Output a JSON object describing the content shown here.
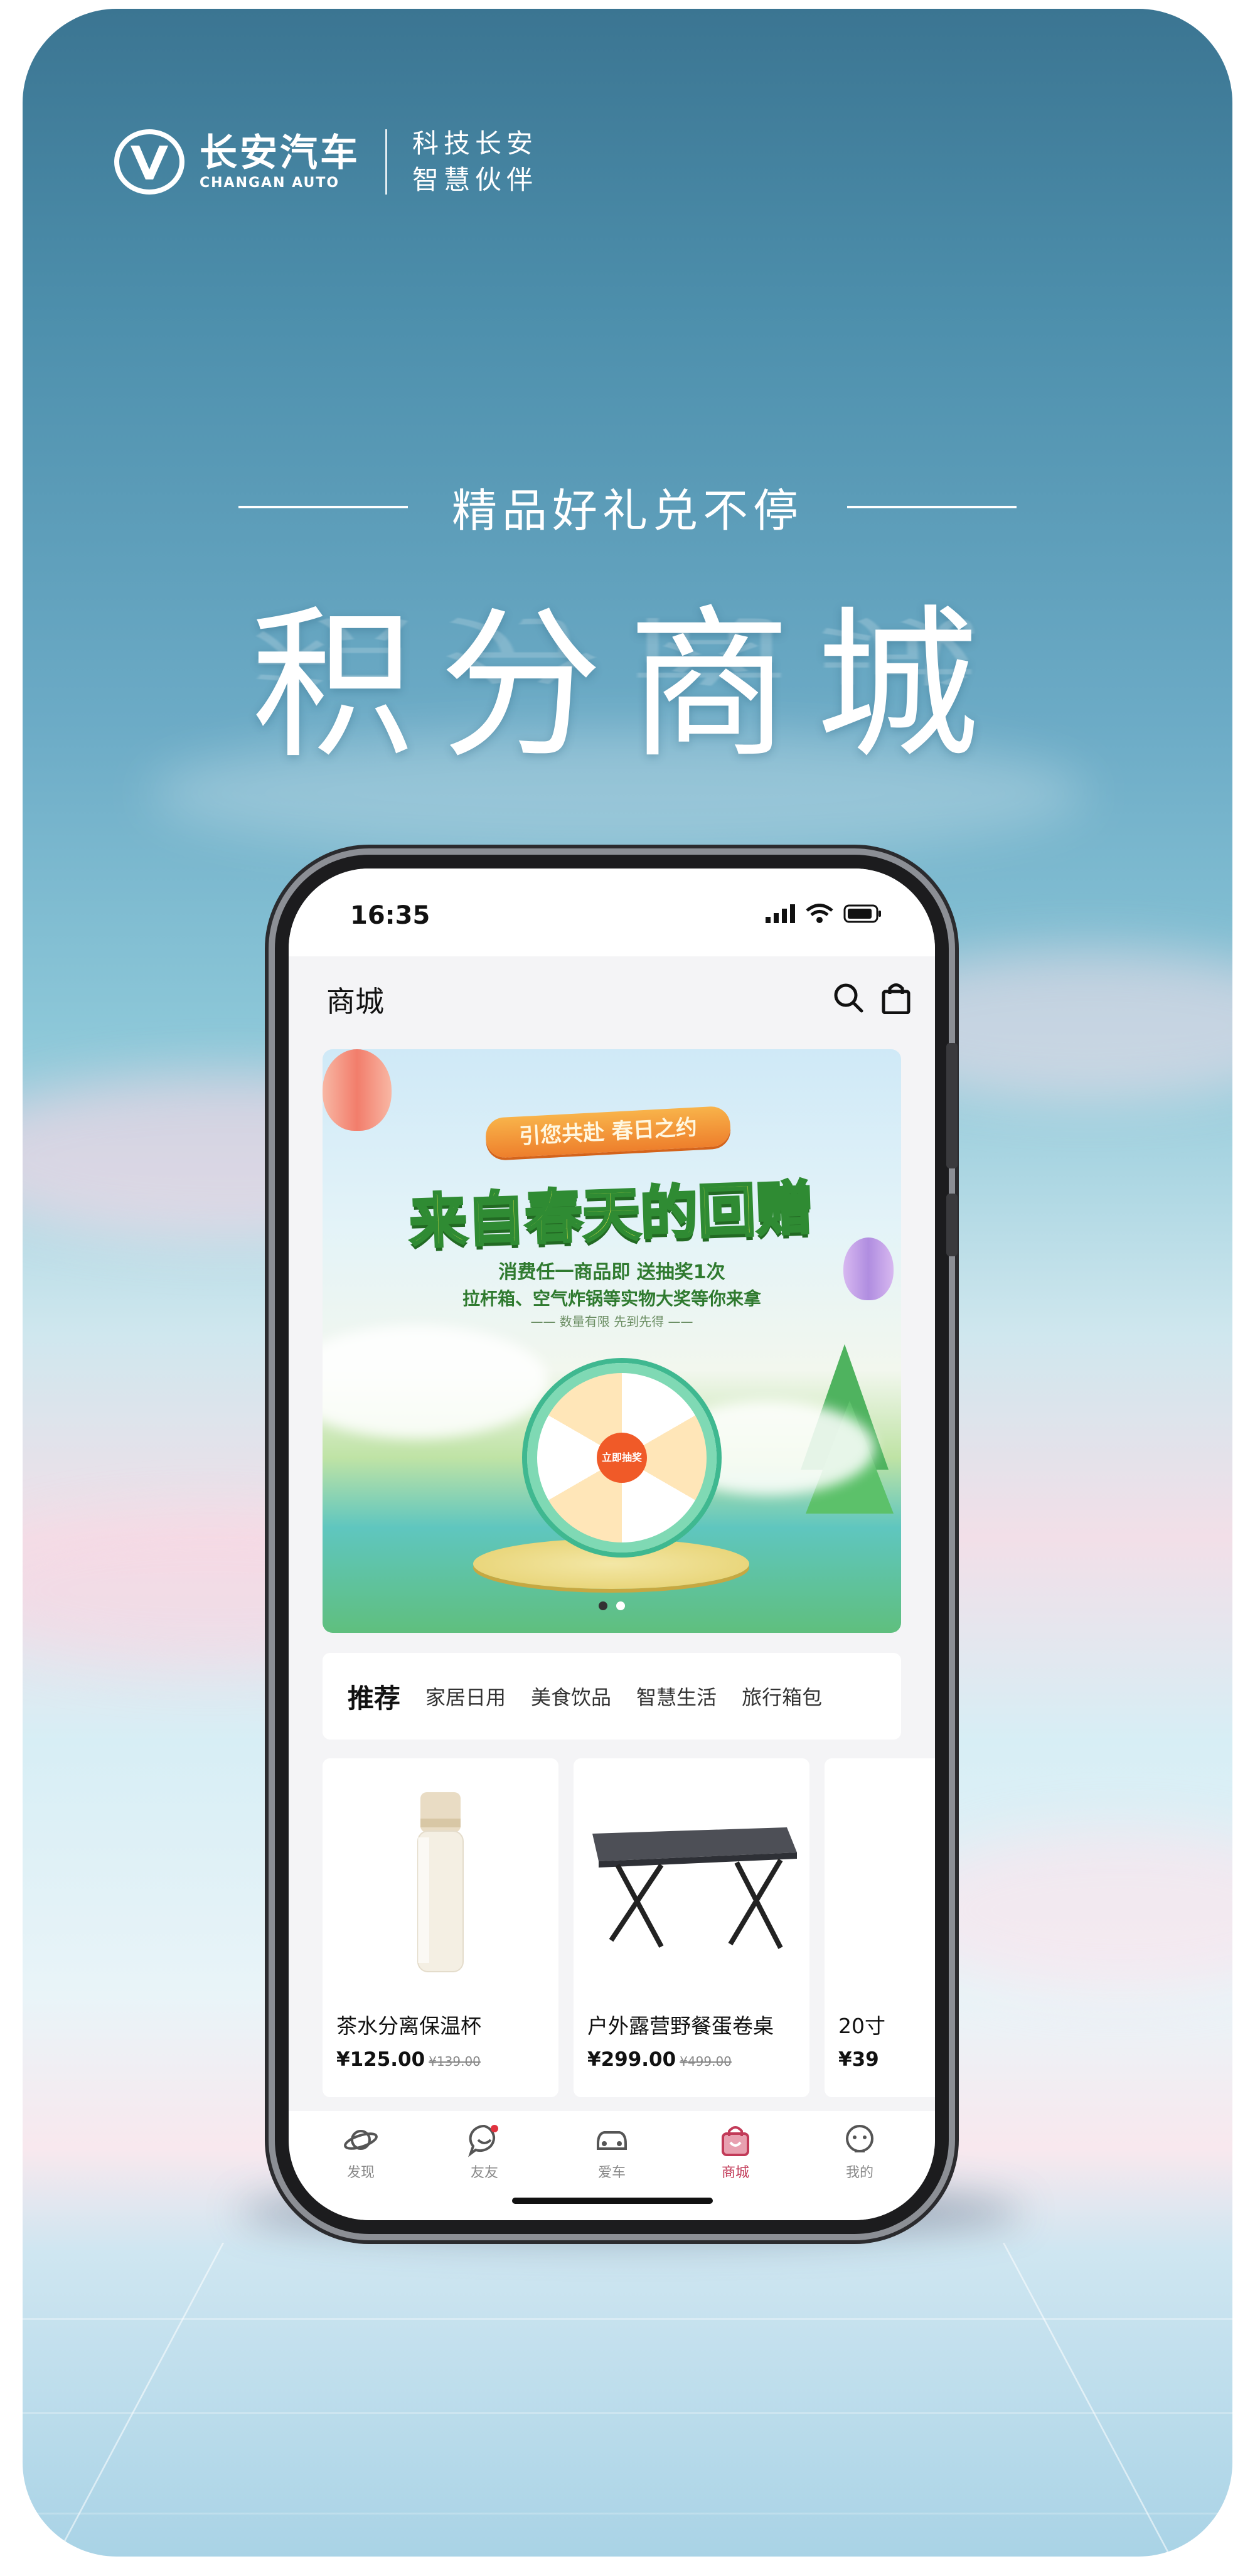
{
  "brand": {
    "name_cn": "长安汽车",
    "name_en": "CHANGAN AUTO",
    "slogan_line1": "科技长安",
    "slogan_line2": "智慧伙伴"
  },
  "headline": {
    "subtitle": "精品好礼兑不停",
    "title": "积分商城"
  },
  "phone": {
    "status": {
      "time": "16:35"
    },
    "app_title": "商城",
    "banner": {
      "tag": "引您共赴 春日之约",
      "title": "来自春天的回赠",
      "line1": "消费任一商品即 送抽奖1次",
      "line2": "拉杆箱、空气炸锅等实物大奖等你来拿",
      "line3": "—— 数量有限 先到先得 ——",
      "wheel_center": "立即抽奖",
      "dots_count": 2,
      "active_dot": 0
    },
    "categories": [
      "推荐",
      "家居日用",
      "美食饮品",
      "智慧生活",
      "旅行箱包"
    ],
    "products": [
      {
        "name": "茶水分离保温杯",
        "price": "¥125.00",
        "original_price": "¥139.00"
      },
      {
        "name": "户外露营野餐蛋卷桌",
        "price": "¥299.00",
        "original_price": "¥499.00"
      },
      {
        "name": "20寸",
        "price": "¥39",
        "original_price": ""
      }
    ],
    "tabs": [
      {
        "label": "发现",
        "icon": "planet-icon"
      },
      {
        "label": "友友",
        "icon": "chat-bubble-icon"
      },
      {
        "label": "爱车",
        "icon": "car-icon"
      },
      {
        "label": "商城",
        "icon": "shopping-bag-icon",
        "active": true
      },
      {
        "label": "我的",
        "icon": "profile-icon"
      }
    ]
  },
  "colors": {
    "accent": "#c23a58",
    "sky_top": "#3b7592",
    "sky_mid": "#8cc7d8"
  }
}
